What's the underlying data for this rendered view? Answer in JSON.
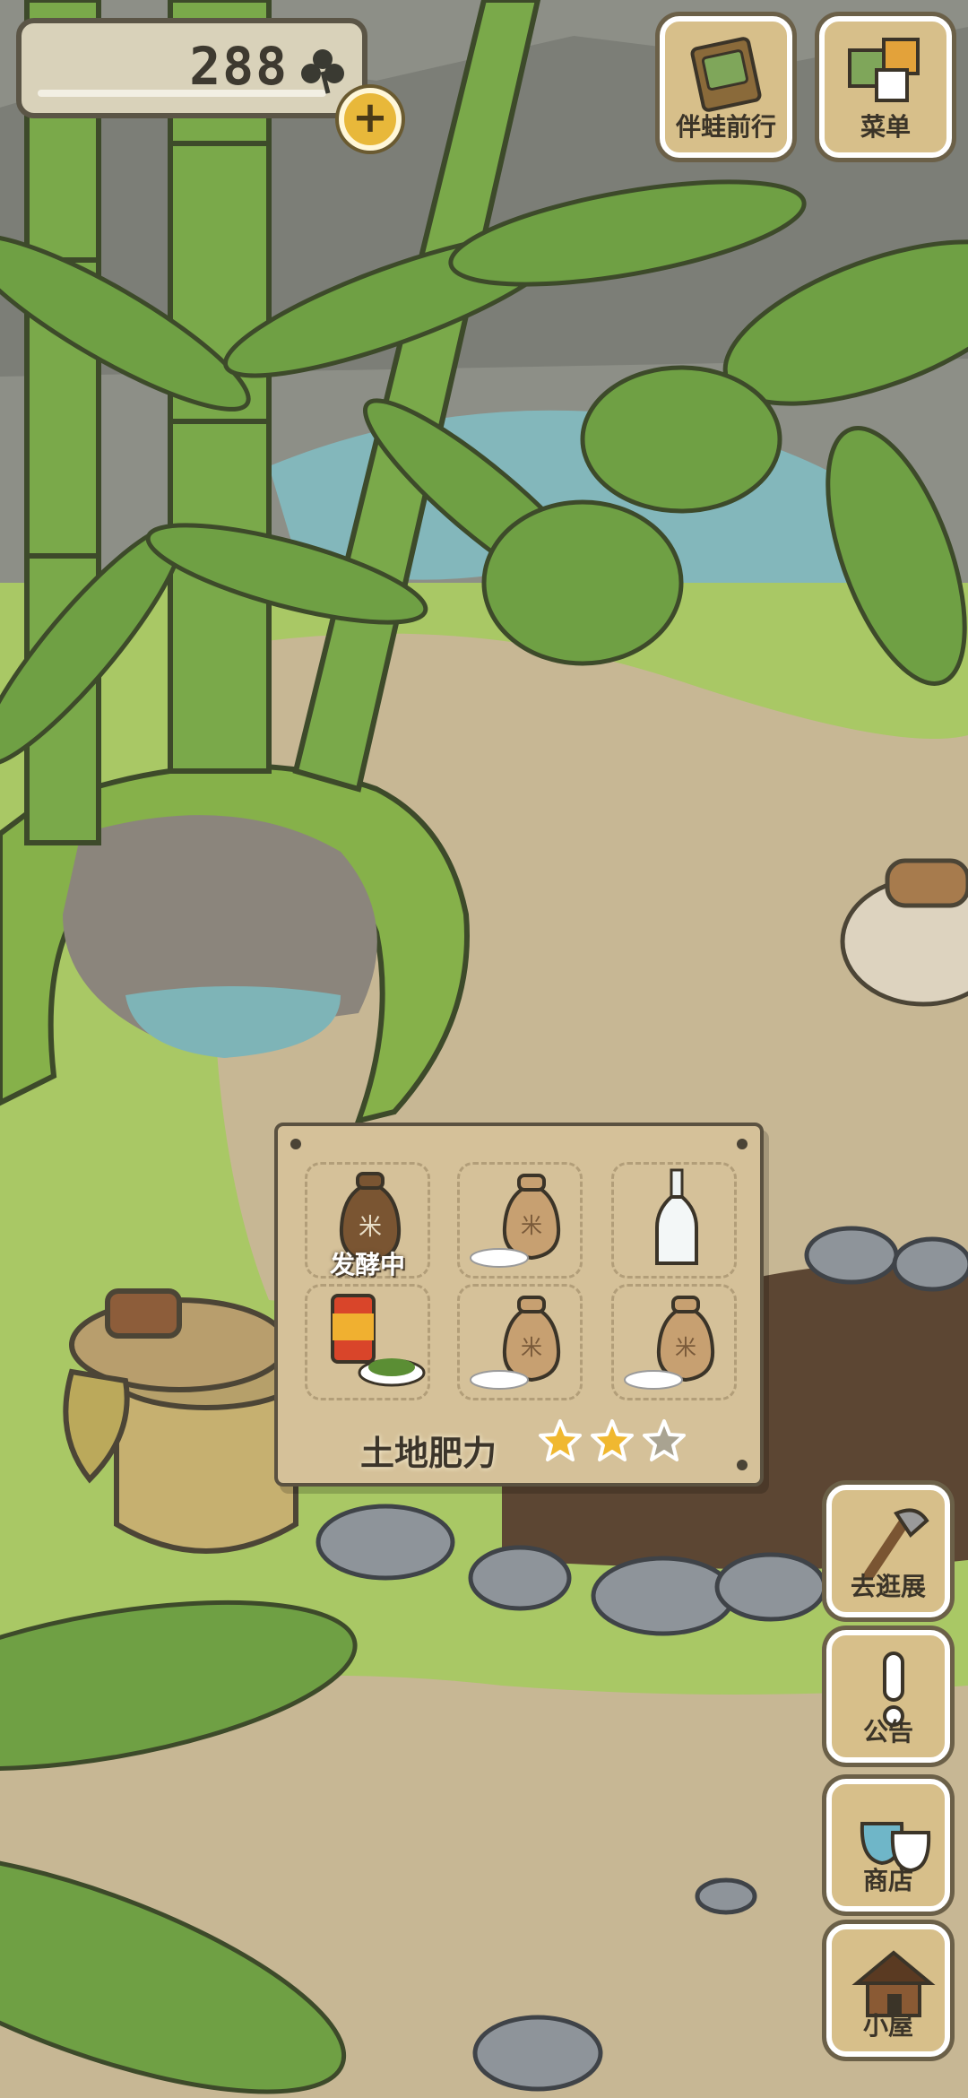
{
  "currency": {
    "amount": "288",
    "icon": "clover-icon",
    "add_icon": "plus-icon"
  },
  "top_buttons": [
    {
      "label": "伴蛙前行",
      "icon": "notebook-icon"
    },
    {
      "label": "菜单",
      "icon": "menu-squares-icon"
    }
  ],
  "side_buttons": [
    {
      "label": "去逛展",
      "icon": "axe-icon"
    },
    {
      "label": "公告",
      "icon": "exclamation-icon"
    },
    {
      "label": "商店",
      "icon": "shop-bags-icon"
    },
    {
      "label": "小屋",
      "icon": "house-icon"
    }
  ],
  "fermentation": {
    "slots": [
      {
        "item": "rice-bag-icon",
        "status": "发酵中"
      },
      {
        "item": "rice-bag-icon",
        "status": ""
      },
      {
        "item": "glass-bottle-icon",
        "status": ""
      },
      {
        "item": "can-and-greens-icon",
        "status": ""
      },
      {
        "item": "rice-bag-icon",
        "status": ""
      },
      {
        "item": "rice-bag-icon",
        "status": ""
      }
    ],
    "fertility_label": "土地肥力",
    "fertility_stars": 2,
    "fertility_max": 3,
    "colors": {
      "star_on": "#f0b830",
      "star_off": "#a9a391"
    }
  }
}
